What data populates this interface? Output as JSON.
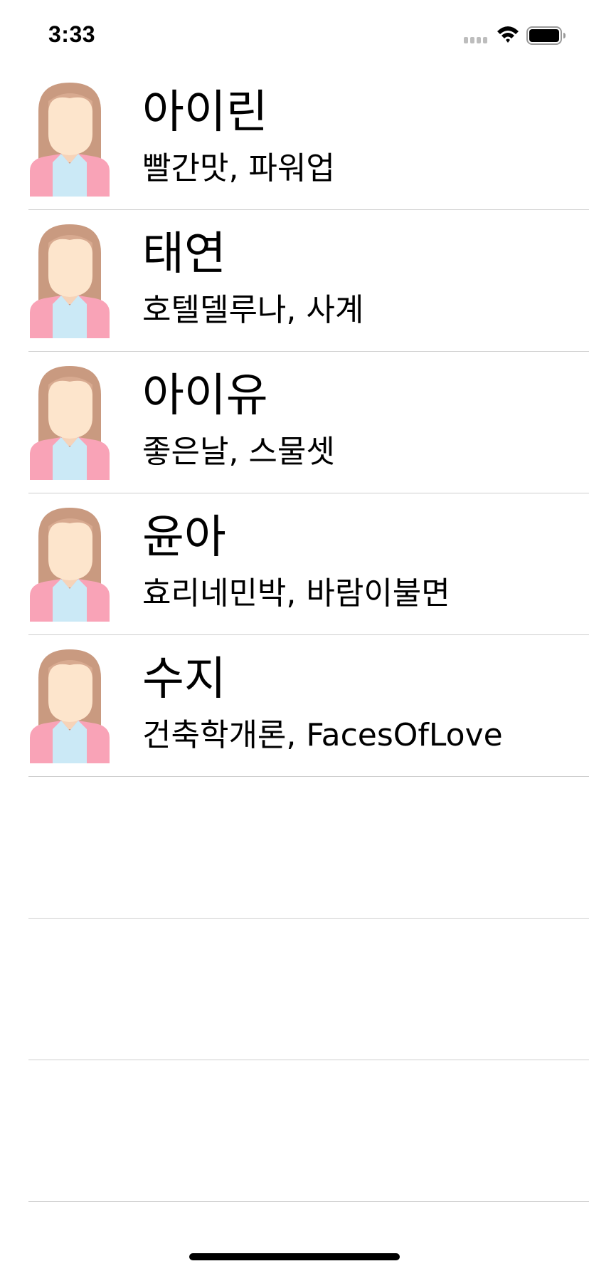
{
  "status_bar": {
    "time": "3:33",
    "icons": [
      "signal-icon",
      "wifi-icon",
      "battery-icon"
    ]
  },
  "rows": [
    {
      "title": "아이린",
      "subtitle": "빨간맛, 파워업",
      "avatar_icon": "woman-avatar-icon"
    },
    {
      "title": "태연",
      "subtitle": "호텔델루나, 사계",
      "avatar_icon": "woman-avatar-icon"
    },
    {
      "title": "아이유",
      "subtitle": "좋은날, 스물셋",
      "avatar_icon": "woman-avatar-icon"
    },
    {
      "title": "윤아",
      "subtitle": "효리네민박, 바람이불면",
      "avatar_icon": "woman-avatar-icon"
    },
    {
      "title": "수지",
      "subtitle": "건축학개론, FacesOfLove",
      "avatar_icon": "woman-avatar-icon"
    }
  ],
  "empty_row_count": 3,
  "colors": {
    "background": "#ffffff",
    "text": "#000000",
    "separator": "#cfcfcf",
    "avatar_hair": "#c99a80",
    "avatar_skin": "#fde5cc",
    "avatar_jacket": "#f9a3b7",
    "avatar_shirt": "#cbe9f6"
  }
}
